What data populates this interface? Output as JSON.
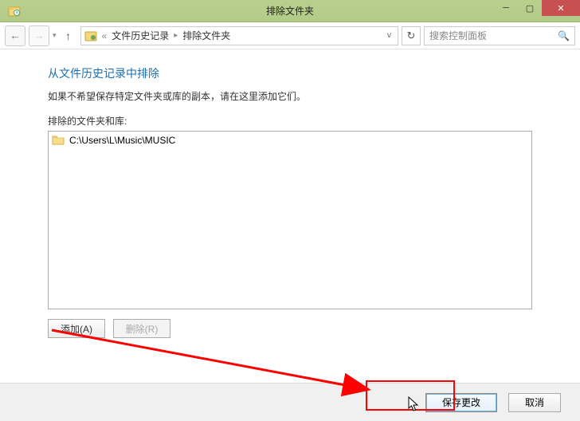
{
  "window": {
    "title": "排除文件夹"
  },
  "nav": {
    "breadcrumb1": "文件历史记录",
    "breadcrumb2": "排除文件夹",
    "search_placeholder": "搜索控制面板"
  },
  "main": {
    "heading": "从文件历史记录中排除",
    "subtext": "如果不希望保存特定文件夹或库的副本，请在这里添加它们。",
    "list_label": "排除的文件夹和库:",
    "items": [
      {
        "path": "C:\\Users\\L\\Music\\MUSIC"
      }
    ],
    "add_label": "添加(A)",
    "remove_label": "删除(R)"
  },
  "footer": {
    "save_label": "保存更改",
    "cancel_label": "取消"
  }
}
